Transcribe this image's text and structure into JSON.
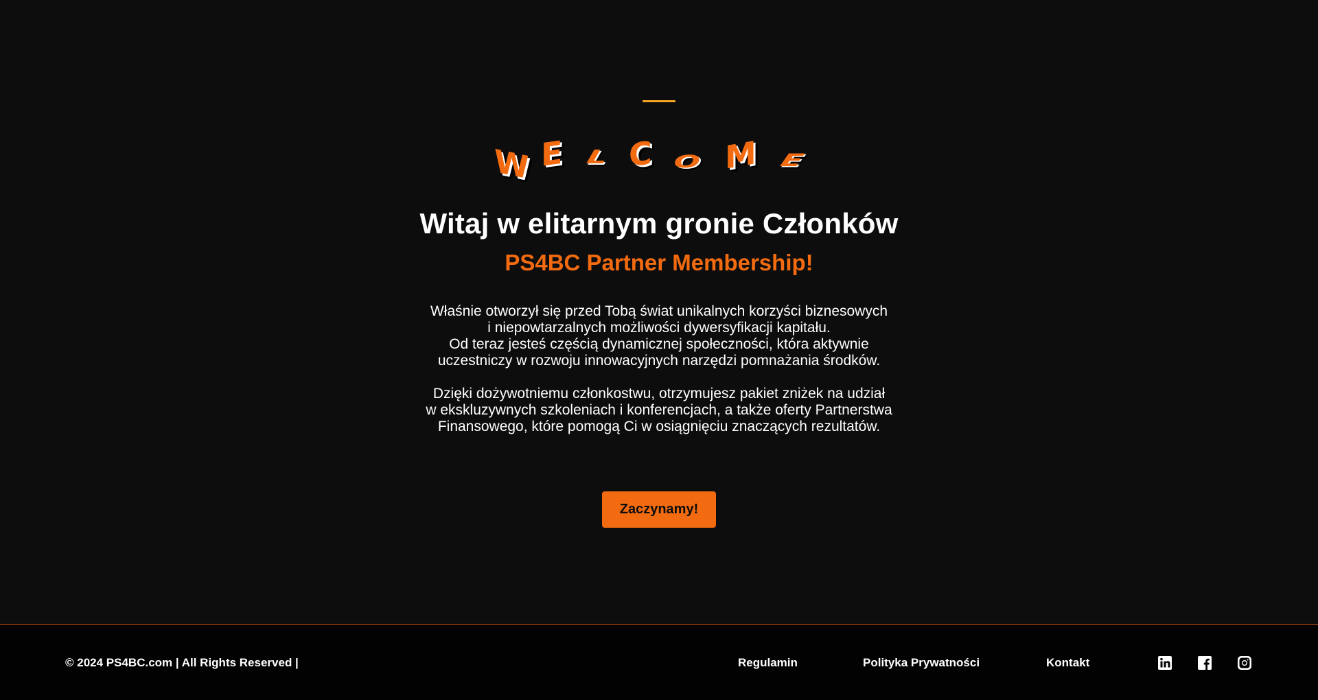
{
  "colors": {
    "background": "#0d0d0e",
    "accent": "#f26b10",
    "accent_line": "#f5a623",
    "footer_bg": "#020202",
    "text": "#ffffff"
  },
  "hero": {
    "welcome_letters": [
      "W",
      "E",
      "L",
      "C",
      "O",
      "M",
      "E"
    ],
    "headline": "Witaj w elitarnym gronie Członków",
    "subheadline": "PS4BC Partner Membership!",
    "paragraph1_lines": [
      "Właśnie otworzył się przed Tobą świat unikalnych korzyści biznesowych",
      "i niepowtarzalnych możliwości dywersyfikacji kapitału.",
      "Od teraz jesteś częścią dynamicznej społeczności, która aktywnie",
      "uczestniczy w rozwoju innowacyjnych narzędzi pomnażania środków."
    ],
    "paragraph2_lines": [
      "Dzięki dożywotniemu członkostwu, otrzymujesz pakiet zniżek na udział",
      "w ekskluzywnych szkoleniach i konferencjach, a także oferty Partnerstwa",
      "Finansowego, które pomogą Ci w osiągnięciu znaczących rezultatów."
    ],
    "cta_label": "Zaczynamy!"
  },
  "footer": {
    "copyright": "© 2024 PS4BC.com | All Rights Reserved |",
    "links": [
      "Regulamin",
      "Polityka Prywatności",
      "Kontakt"
    ],
    "social_icons": [
      "linkedin-icon",
      "facebook-icon",
      "instagram-icon"
    ]
  }
}
